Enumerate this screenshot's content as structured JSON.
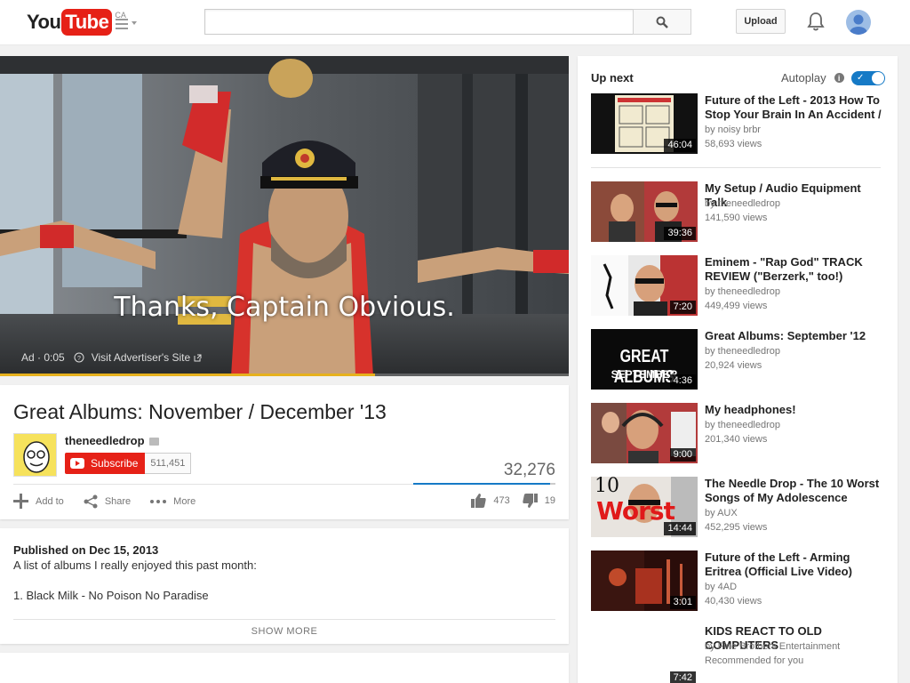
{
  "masthead": {
    "logo_you": "You",
    "logo_tube": "Tube",
    "logo_region": "CA",
    "search_placeholder": "",
    "upload_label": "Upload"
  },
  "player": {
    "caption": "Thanks, Captain Obvious.",
    "ad_label": "Ad · 0:05",
    "visit_label": "Visit Advertiser's Site",
    "ad_progress_fraction": 0.66
  },
  "video": {
    "title": "Great Albums: November / December '13",
    "channel": "theneedledrop",
    "subscribe_label": "Subscribe",
    "subscriber_count": "511,451",
    "view_count": "32,276",
    "like_fraction": 0.96,
    "actions": {
      "add_to": "Add to",
      "share": "Share",
      "more": "More"
    },
    "likes": "473",
    "dislikes": "19"
  },
  "description": {
    "published": "Published on Dec 15, 2013",
    "line1": "A list of albums I really enjoyed this past month:",
    "line2": "1. Black Milk - No Poison No Paradise",
    "show_more": "SHOW MORE"
  },
  "sidebar": {
    "up_next_label": "Up next",
    "autoplay_label": "Autoplay",
    "autoplay_on": true,
    "items": [
      {
        "title": "Future of the Left - 2013 How To Stop Your Brain In An Accident /",
        "channel": "by noisy brbr",
        "views": "58,693 views",
        "duration": "46:04"
      },
      {
        "title": "My Setup / Audio Equipment Talk",
        "channel": "by theneedledrop",
        "views": "141,590 views",
        "duration": "39:36"
      },
      {
        "title": "Eminem - \"Rap God\" TRACK REVIEW (\"Berzerk,\" too!)",
        "channel": "by theneedledrop",
        "views": "449,499 views",
        "duration": "7:20"
      },
      {
        "title": "Great Albums: September '12",
        "channel": "by theneedledrop",
        "views": "20,924 views",
        "duration": "4:36",
        "thumb_text_1": "GREAT ALBUMS",
        "thumb_text_2": "SEPTEMBER"
      },
      {
        "title": "My headphones!",
        "channel": "by theneedledrop",
        "views": "201,340 views",
        "duration": "9:00"
      },
      {
        "title": "The Needle Drop - The 10 Worst Songs of My Adolescence",
        "channel": "by AUX",
        "views": "452,295 views",
        "duration": "14:44",
        "thumb_text_1": "10",
        "thumb_text_2": "Worst"
      },
      {
        "title": "Future of the Left - Arming Eritrea (Official Live Video)",
        "channel": "by 4AD",
        "views": "40,430 views",
        "duration": "3:01"
      },
      {
        "title": "KIDS REACT TO OLD COMPUTERS",
        "channel": "by Fine Brothers Entertainment",
        "views": "Recommended for you",
        "duration": "7:42"
      }
    ]
  }
}
